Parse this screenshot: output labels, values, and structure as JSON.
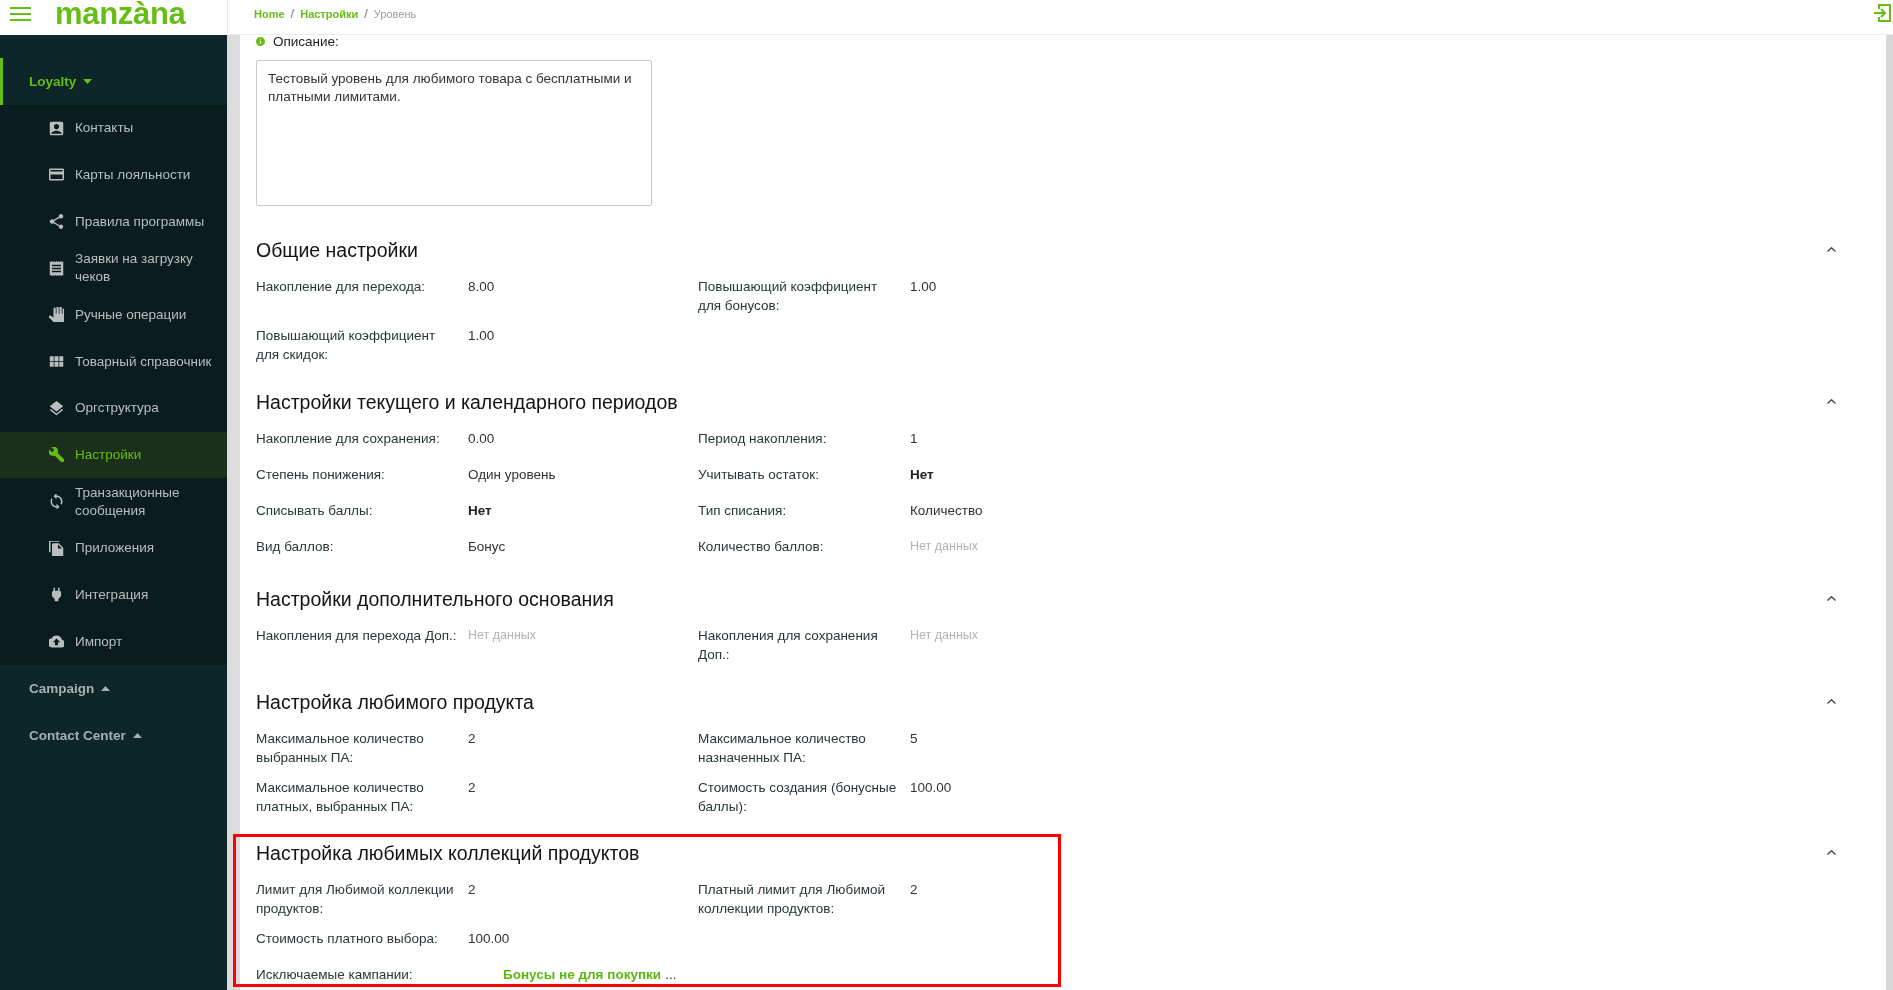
{
  "header": {
    "logo": "manzàna",
    "breadcrumbs": [
      {
        "kind": "link",
        "text": "Home"
      },
      {
        "kind": "separator",
        "text": "/"
      },
      {
        "kind": "link",
        "text": "Настройки"
      },
      {
        "kind": "separator",
        "text": "/"
      },
      {
        "kind": "current",
        "text": "Уровень"
      }
    ]
  },
  "sidebar": {
    "groups": [
      {
        "label": "Loyalty",
        "selected": true,
        "expanded": true,
        "items": [
          {
            "label": "Контакты",
            "selected": false
          },
          {
            "label": "Карты лояльности",
            "selected": false
          },
          {
            "label": "Правила программы",
            "selected": false
          },
          {
            "label": "Заявки на загрузку чеков",
            "selected": false
          },
          {
            "label": "Ручные операции",
            "selected": false
          },
          {
            "label": "Товарный справочник",
            "selected": false
          },
          {
            "label": "Оргструктура",
            "selected": false
          },
          {
            "label": "Настройки",
            "selected": true
          },
          {
            "label": "Транзакционные сообщения",
            "selected": false
          },
          {
            "label": "Приложения",
            "selected": false
          },
          {
            "label": "Интеграция",
            "selected": false
          },
          {
            "label": "Импорт",
            "selected": false
          }
        ]
      },
      {
        "label": "Campaign",
        "selected": false,
        "expanded": false
      },
      {
        "label": "Contact Center",
        "selected": false,
        "expanded": false
      }
    ]
  },
  "description": {
    "label": "Описание:",
    "value": "Тестовый уровень для любимого товара с бесплатными и платными лимитами."
  },
  "sections": [
    {
      "title": "Общие настройки",
      "expanded": true,
      "highlighted": false,
      "rows": [
        {
          "fields": [
            {
              "label": "Накопление для перехода:",
              "value": "8.00",
              "kind": "plain"
            },
            {
              "label": "Повышающий коэффициент для бонусов:",
              "value": "1.00",
              "kind": "plain"
            }
          ]
        },
        {
          "fields": [
            {
              "label": "Повышающий коэффициент для скидок:",
              "value": "1.00",
              "kind": "plain"
            }
          ]
        }
      ]
    },
    {
      "title": "Настройки текущего и календарного периодов",
      "expanded": true,
      "highlighted": false,
      "rows": [
        {
          "fields": [
            {
              "label": "Накопление для сохранения:",
              "value": "0.00",
              "kind": "plain"
            },
            {
              "label": "Период накопления:",
              "value": "1",
              "kind": "plain"
            }
          ]
        },
        {
          "fields": [
            {
              "label": "Степень понижения:",
              "value": "Один уровень",
              "kind": "plain"
            },
            {
              "label": "Учитывать остаток:",
              "value": "Нет",
              "kind": "strong"
            }
          ]
        },
        {
          "fields": [
            {
              "label": "Списывать баллы:",
              "value": "Нет",
              "kind": "strong"
            },
            {
              "label": "Тип списания:",
              "value": "Количество",
              "kind": "plain"
            }
          ]
        },
        {
          "fields": [
            {
              "label": "Вид баллов:",
              "value": "Бонус",
              "kind": "plain"
            },
            {
              "label": "Количество баллов:",
              "value": "Нет данных",
              "kind": "none"
            }
          ]
        }
      ]
    },
    {
      "title": "Настройки дополнительного основания",
      "expanded": true,
      "highlighted": false,
      "rows": [
        {
          "fields": [
            {
              "label": "Накопления для перехода Доп.:",
              "value": "Нет данных",
              "kind": "none"
            },
            {
              "label": "Накопления для сохранения Доп.:",
              "value": "Нет данных",
              "kind": "none"
            }
          ]
        }
      ]
    },
    {
      "title": "Настройка любимого продукта",
      "expanded": true,
      "highlighted": false,
      "rows": [
        {
          "fields": [
            {
              "label": "Максимальное количество выбранных ПА:",
              "value": "2",
              "kind": "plain"
            },
            {
              "label": "Максимальное количество назначенных ПА:",
              "value": "5",
              "kind": "plain"
            }
          ]
        },
        {
          "fields": [
            {
              "label": "Максимальное количество платных, выбранных ПА:",
              "value": "2",
              "kind": "plain"
            },
            {
              "label": "Стоимость создания (бонусные баллы):",
              "value": "100.00",
              "kind": "plain"
            }
          ]
        }
      ]
    },
    {
      "title": "Настройка любимых коллекций продуктов",
      "expanded": true,
      "highlighted": true,
      "rows": [
        {
          "fields": [
            {
              "label": "Лимит для Любимой коллекции продуктов:",
              "value": "2",
              "kind": "plain"
            },
            {
              "label": "Платный лимит для Любимой коллекции продуктов:",
              "value": "2",
              "kind": "plain"
            }
          ]
        },
        {
          "fields": [
            {
              "label": "Стоимость платного выбора:",
              "value": "100.00",
              "kind": "plain"
            }
          ]
        },
        {
          "fields": [
            {
              "label": "Исключаемые кампании:",
              "value": "Бонусы не для покупки",
              "more": "...",
              "kind": "link"
            }
          ]
        }
      ]
    }
  ]
}
